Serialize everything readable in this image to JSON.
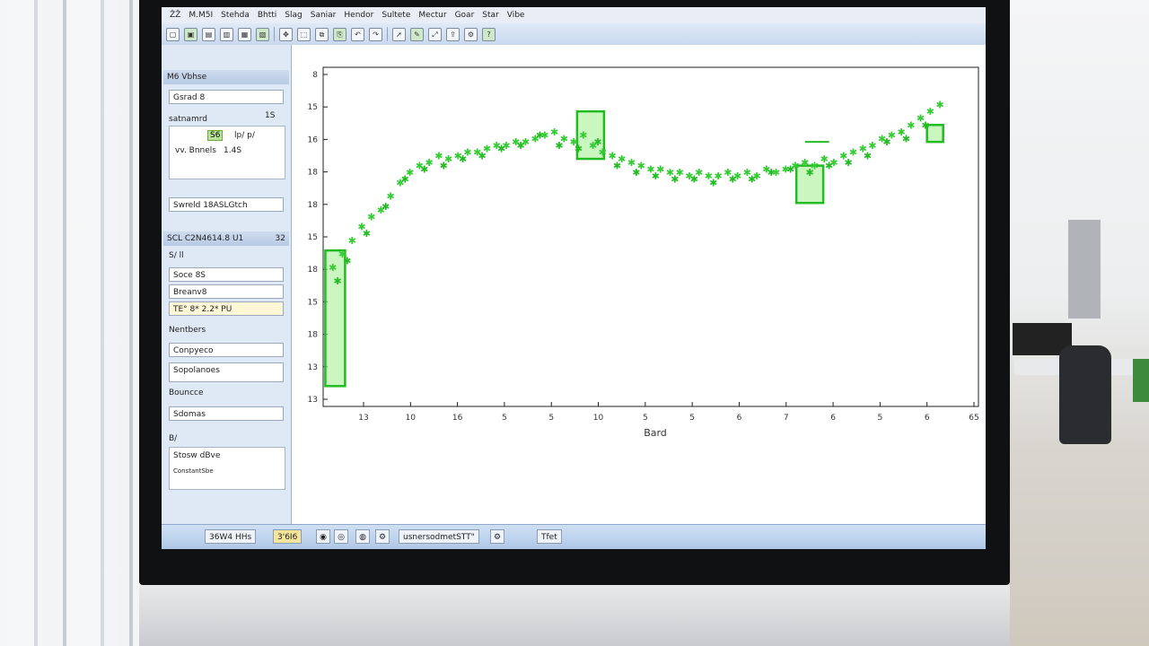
{
  "menu": [
    "ŽŽ",
    "M.M5I",
    "Stehda",
    "Bhtti",
    "Slag",
    "Saniar",
    "Hendor",
    "Sultete",
    "Mectur",
    "Goar",
    "Star",
    "Vibe"
  ],
  "toolbar_icons": [
    "open-icon",
    "save-icon",
    "print-icon",
    "zoom-in-icon",
    "zoom-out-icon",
    "grid-icon",
    "pan-icon",
    "select-icon",
    "copy-icon",
    "paste-icon",
    "undo-icon",
    "redo-icon",
    "cursor-icon",
    "marker-icon",
    "fit-icon",
    "export-icon",
    "settings-icon",
    "help-icon"
  ],
  "left_panel": {
    "section1_title": "M6 Vbhse",
    "field1": "Gsrad 8",
    "coord_label": "1S",
    "readout_label": "satnamrd",
    "chip_value": "S6",
    "chip_suffix": "lp/ p/",
    "sub_label": "vv. Bnnels",
    "sub_value": "1.4S",
    "note": "Swreld 18ASLGtch",
    "section2_title": "SCL C2N4614.8 U1",
    "section2_value": "32",
    "sub_section": "S/ ll",
    "field2": "Soce 8S",
    "field3": "Breanv8",
    "toggle_label": "TE° 8* 2.2* PU",
    "section3_title": "Nentbers",
    "field4": "Conpyeco",
    "field5": "Sopolanoes",
    "field6": "Bouncce",
    "field7": "Sdomas",
    "section4_title": "B/",
    "field8": "Stosw dBve",
    "field9": "ConstantSbe"
  },
  "status": {
    "item1": "36W4 HHs",
    "item2": "3'6I6",
    "item3": "usnersodmetSTT\"",
    "item4": "Tfet"
  },
  "chart_data": {
    "type": "scatter",
    "title": "",
    "xlabel": "Bard",
    "ylabel": "",
    "x_tick_labels": [
      "13",
      "10",
      "16",
      "5",
      "5",
      "10",
      "5",
      "5",
      "6",
      "7",
      "6",
      "5",
      "6",
      "65"
    ],
    "y_tick_labels": [
      "8",
      "15",
      "16",
      "18",
      "18",
      "15",
      "18",
      "15",
      "18",
      "13",
      "13"
    ],
    "series": [
      {
        "marker": "star",
        "color": "#33cc33",
        "x": [
          0.2,
          0.4,
          0.6,
          0.8,
          1.0,
          1.2,
          1.4,
          1.6,
          1.8,
          2.0,
          2.2,
          2.4,
          2.6,
          2.8,
          3.0,
          3.2,
          3.4,
          3.6,
          3.8,
          4.0,
          4.2,
          4.4,
          4.6,
          4.8,
          5.0,
          5.2,
          5.4,
          5.6,
          5.8,
          6.0,
          6.2,
          6.4,
          6.6,
          6.8,
          7.0,
          7.2,
          7.4,
          7.6,
          7.8,
          8.0,
          8.2,
          8.4,
          8.6,
          8.8,
          9.0,
          9.2,
          9.4,
          9.6,
          9.8,
          10.0,
          10.2,
          10.4,
          10.6,
          10.8,
          11.0,
          11.2,
          11.4,
          11.6,
          11.8,
          12.0,
          12.2,
          12.4,
          12.6,
          12.8
        ],
        "y": [
          15.4,
          15.0,
          14.6,
          14.2,
          13.9,
          13.7,
          13.3,
          12.9,
          12.6,
          12.4,
          12.3,
          12.1,
          12.2,
          12.1,
          12.0,
          12.0,
          11.9,
          11.8,
          11.8,
          11.7,
          11.7,
          11.6,
          11.5,
          11.4,
          11.6,
          11.7,
          11.5,
          11.8,
          12.0,
          12.1,
          12.2,
          12.3,
          12.4,
          12.5,
          12.5,
          12.6,
          12.6,
          12.7,
          12.6,
          12.7,
          12.7,
          12.6,
          12.7,
          12.6,
          12.7,
          12.5,
          12.6,
          12.5,
          12.4,
          12.3,
          12.4,
          12.2,
          12.3,
          12.1,
          12.0,
          11.9,
          11.8,
          11.6,
          11.5,
          11.4,
          11.2,
          11.0,
          10.8,
          10.6
        ]
      },
      {
        "marker": "star-offset",
        "color": "#22bb22",
        "x": [
          0.3,
          0.5,
          0.9,
          1.3,
          1.7,
          2.1,
          2.5,
          2.9,
          3.3,
          3.7,
          4.1,
          4.5,
          4.9,
          5.3,
          5.7,
          6.1,
          6.5,
          6.9,
          7.3,
          7.7,
          8.1,
          8.5,
          8.9,
          9.3,
          9.7,
          10.1,
          10.5,
          10.9,
          11.3,
          11.7,
          12.1,
          12.5
        ],
        "y": [
          15.8,
          15.2,
          14.4,
          13.6,
          12.8,
          12.5,
          12.4,
          12.2,
          12.1,
          11.9,
          11.8,
          11.5,
          11.8,
          11.9,
          11.7,
          12.4,
          12.6,
          12.7,
          12.8,
          12.8,
          12.9,
          12.8,
          12.8,
          12.6,
          12.5,
          12.6,
          12.4,
          12.3,
          12.1,
          11.7,
          11.6,
          11.2
        ]
      }
    ],
    "boxes": [
      {
        "x": 0.25,
        "y_low": 18.9,
        "y_high": 14.9
      },
      {
        "x": 5.55,
        "y_low": 12.2,
        "y_high": 10.8
      },
      {
        "x": 10.1,
        "y_low": 13.5,
        "y_high": 12.4
      },
      {
        "x": 12.7,
        "y_low": 11.7,
        "y_high": 11.2
      }
    ],
    "reference_line": {
      "x_start": 10.0,
      "x_end": 10.5,
      "y": 11.7
    },
    "xlim": [
      0,
      13.6
    ],
    "ylim": [
      19.5,
      9.5
    ],
    "grid": false
  }
}
